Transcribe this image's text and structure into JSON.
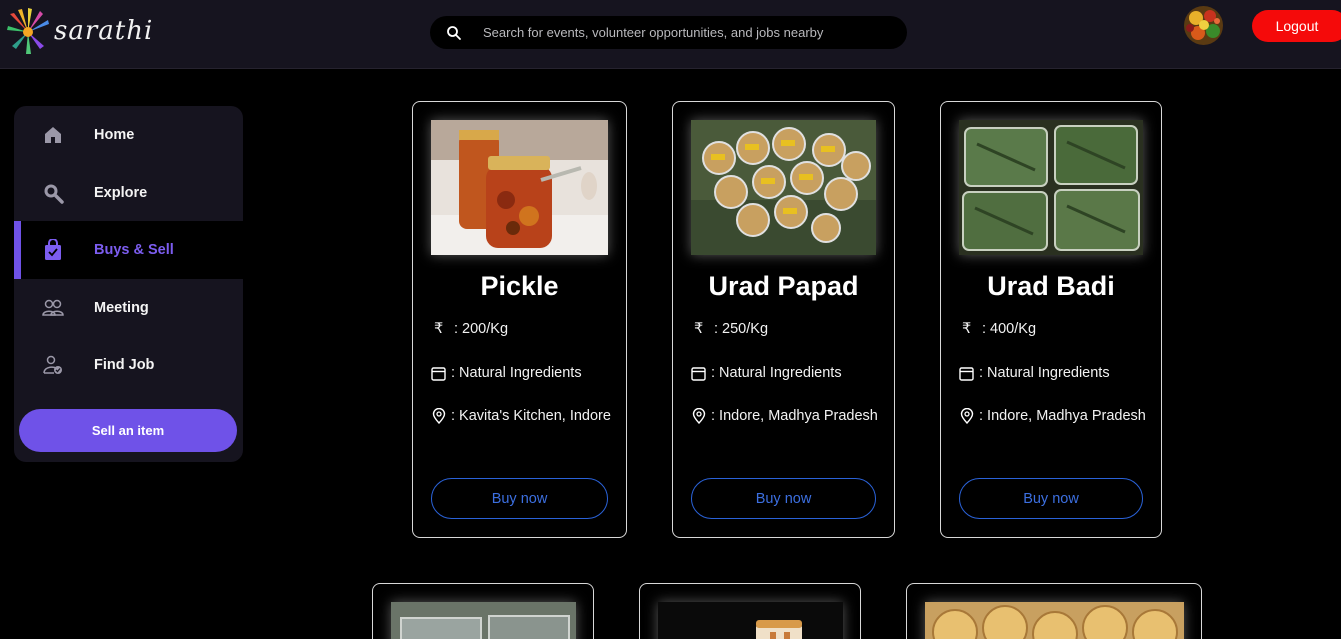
{
  "header": {
    "brand": "sarathi",
    "search_placeholder": "Search for events, volunteer opportunities, and jobs nearby",
    "logout_label": "Logout"
  },
  "sidebar": {
    "items": [
      {
        "label": "Home",
        "icon": "home-icon"
      },
      {
        "label": "Explore",
        "icon": "search-icon"
      },
      {
        "label": "Buys & Sell",
        "icon": "shopping-bag-icon",
        "active": true
      },
      {
        "label": "Meeting",
        "icon": "people-icon"
      },
      {
        "label": "Find Job",
        "icon": "user-check-icon"
      }
    ],
    "sell_label": "Sell an item"
  },
  "products": [
    {
      "title": "Pickle",
      "price": ": 200/Kg",
      "detail": ": Natural Ingredients",
      "location": ": Kavita's Kitchen, Indore",
      "buy_label": "Buy now"
    },
    {
      "title": "Urad Papad",
      "price": ": 250/Kg",
      "detail": ": Natural Ingredients",
      "location": ": Indore, Madhya Pradesh",
      "buy_label": "Buy now"
    },
    {
      "title": "Urad Badi",
      "price": ": 400/Kg",
      "detail": ": Natural Ingredients",
      "location": ": Indore, Madhya Pradesh",
      "buy_label": "Buy now"
    }
  ],
  "currency_symbol": "₹",
  "colors": {
    "accent": "#6f52e8",
    "logout": "#f50a0a",
    "buy_outline": "#2a62d8",
    "panel": "#16141f"
  }
}
